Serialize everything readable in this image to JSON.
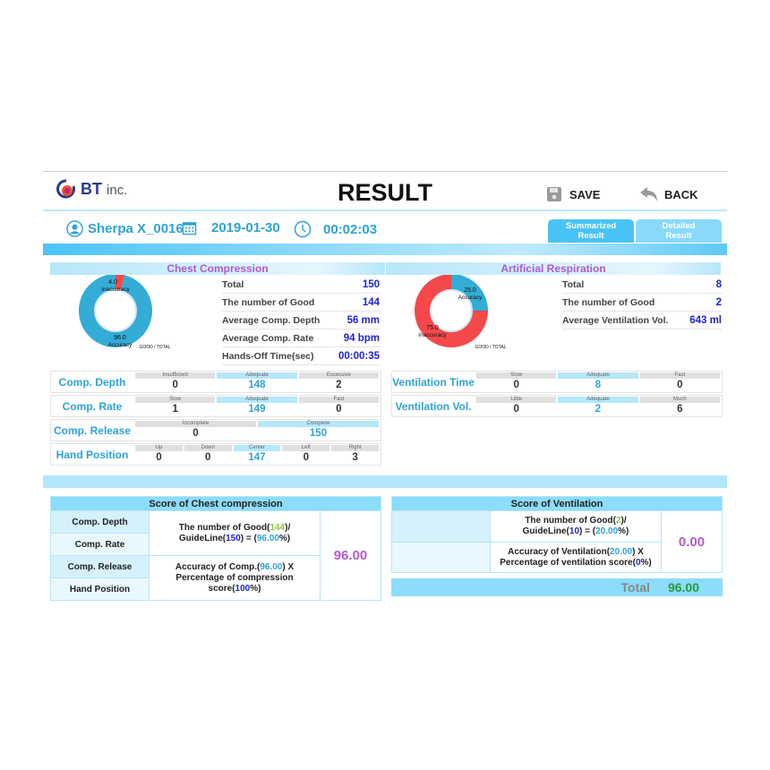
{
  "header": {
    "brand": "BT",
    "brand_suffix": "inc.",
    "title": "RESULT",
    "save_label": "SAVE",
    "back_label": "BACK"
  },
  "info": {
    "user": "Sherpa X_0016",
    "date": "2019-01-30",
    "time": "00:02:03"
  },
  "tabs": [
    {
      "label_line1": "Summarized",
      "label_line2": "Result",
      "active": true
    },
    {
      "label_line1": "Detailed",
      "label_line2": "Result",
      "active": false
    }
  ],
  "chest": {
    "title": "Chest Compression",
    "donut": {
      "accuracy": 96.0,
      "inaccuracy": 4.0,
      "accuracy_label": "Accuracy",
      "inaccuracy_label": "Inaccuracy",
      "accuracy_text": "96.0",
      "inaccuracy_text": "4.0",
      "caption": "GOOD / TOTAL"
    },
    "stats": [
      {
        "label": "Total",
        "value": "150"
      },
      {
        "label": "The number of Good",
        "value": "144"
      },
      {
        "label": "Average Comp. Depth",
        "value": "56 mm"
      },
      {
        "label": "Average Comp. Rate",
        "value": "94 bpm"
      },
      {
        "label": "Hands-Off Time(sec)",
        "value": "00:00:35"
      }
    ],
    "grids": [
      {
        "label": "Comp. Depth",
        "cells": [
          {
            "h": "Insufficient",
            "v": "0"
          },
          {
            "h": "Adequate",
            "v": "148",
            "hi": true
          },
          {
            "h": "Excessive",
            "v": "2"
          }
        ]
      },
      {
        "label": "Comp. Rate",
        "cells": [
          {
            "h": "Slow",
            "v": "1"
          },
          {
            "h": "Adequate",
            "v": "149",
            "hi": true
          },
          {
            "h": "Fast",
            "v": "0"
          }
        ]
      },
      {
        "label": "Comp. Release",
        "cells": [
          {
            "h": "Incomplete",
            "v": "0"
          },
          {
            "h": "Complete",
            "v": "150",
            "hi": true
          }
        ]
      },
      {
        "label": "Hand Position",
        "cells": [
          {
            "h": "Up",
            "v": "0"
          },
          {
            "h": "Down",
            "v": "0"
          },
          {
            "h": "Center",
            "v": "147",
            "hi": true
          },
          {
            "h": "Left",
            "v": "0"
          },
          {
            "h": "Right",
            "v": "3"
          }
        ]
      }
    ]
  },
  "resp": {
    "title": "Artificial Respiration",
    "donut": {
      "accuracy": 25.0,
      "inaccuracy": 75.0,
      "accuracy_label": "Accuracy",
      "inaccuracy_label": "Inaccuracy",
      "accuracy_text": "25.0",
      "inaccuracy_text": "75.0",
      "caption": "GOOD / TOTAL"
    },
    "stats": [
      {
        "label": "Total",
        "value": "8"
      },
      {
        "label": "The number of Good",
        "value": "2"
      },
      {
        "label": "Average Ventilation Vol.",
        "value": "643 ml"
      }
    ],
    "grids": [
      {
        "label": "Ventilation Time",
        "cells": [
          {
            "h": "Slow",
            "v": "0"
          },
          {
            "h": "Adequate",
            "v": "8",
            "hi": true
          },
          {
            "h": "Fast",
            "v": "0"
          }
        ]
      },
      {
        "label": "Ventilation Vol.",
        "cells": [
          {
            "h": "Little",
            "v": "0"
          },
          {
            "h": "Adequate",
            "v": "2",
            "hi": true
          },
          {
            "h": "Much",
            "v": "6"
          }
        ]
      }
    ]
  },
  "score_chest": {
    "title": "Score of Chest compression",
    "labels": [
      "Comp. Depth",
      "Comp. Rate",
      "Comp. Release",
      "Hand Position"
    ],
    "line1a": "The number of Good(",
    "good": "144",
    "line1b": ")/",
    "line2a": "GuideLine(",
    "guide": "150",
    "line2b": ") = (",
    "pct": "96.00",
    "line2c": "%)",
    "line3a": "Accuracy of Comp.(",
    "acc": "96.00",
    "line3b": ") X",
    "line4a": "Percentage of compression score(",
    "weight": "100",
    "line4b": "%)",
    "score": "96.00"
  },
  "score_vent": {
    "title": "Score of Ventilation",
    "line1a": "The number of Good(",
    "good": "2",
    "line1b": ")/",
    "line2a": "GuideLine(",
    "guide": "10",
    "line2b": ") = (",
    "pct": "20.00",
    "line2c": "%)",
    "line3a": "Accuracy of Ventilation(",
    "acc": "20.00",
    "line3b": ") X",
    "line4a": "Percentage of ventilation score(",
    "weight": "0",
    "line4b": "%)",
    "score": "0.00"
  },
  "total": {
    "label": "Total",
    "value": "96.00"
  },
  "colors": {
    "accuracy": "#33acd6",
    "inaccuracy": "#f5484a",
    "accent": "#2ca3d6"
  }
}
